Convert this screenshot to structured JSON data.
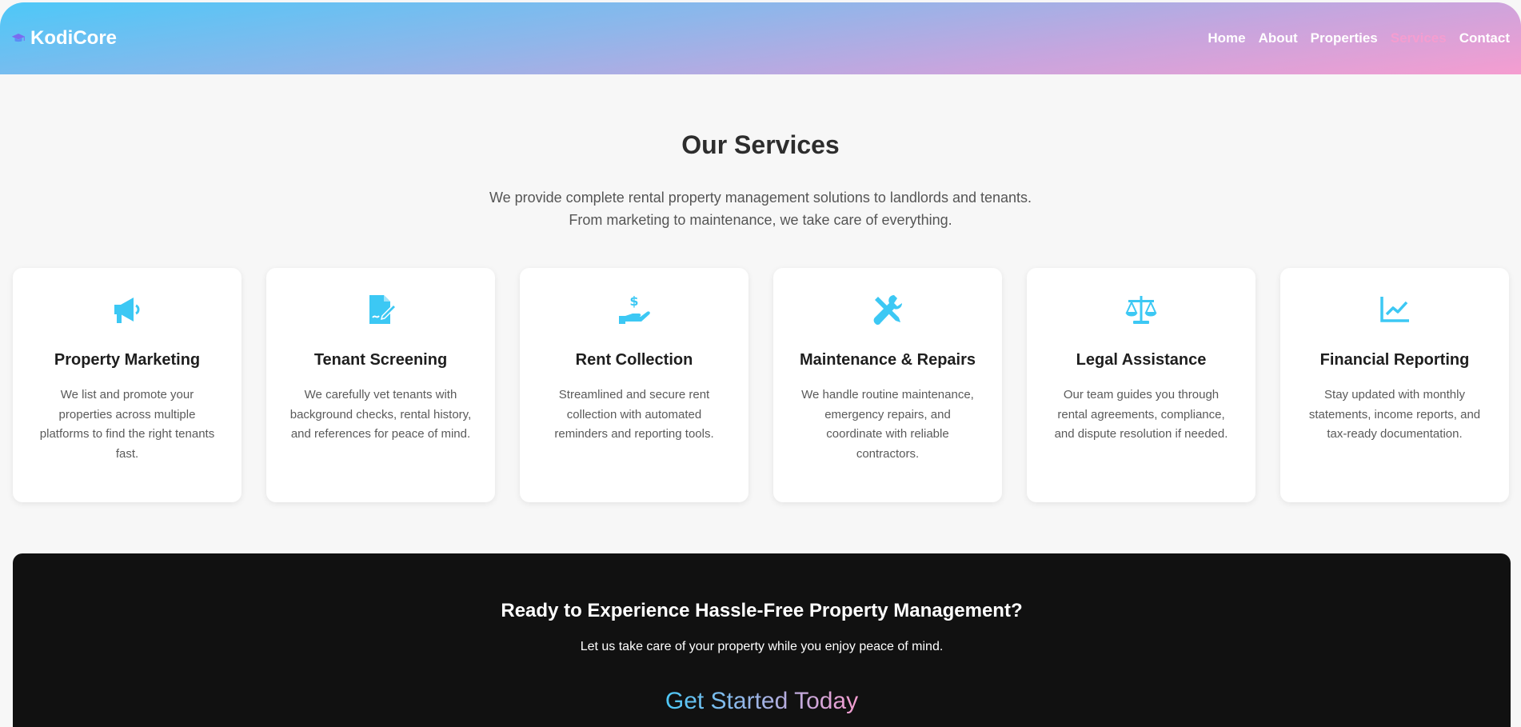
{
  "nav": {
    "brand": "KodiCore",
    "brand_icon": "graduation-cap-icon",
    "links": [
      "Home",
      "About",
      "Properties",
      "Services",
      "Contact"
    ],
    "active": "Services"
  },
  "services": {
    "title": "Our Services",
    "intro_line1": "We provide complete rental property management solutions to landlords and tenants.",
    "intro_line2": "From marketing to maintenance, we take care of everything.",
    "cards": [
      {
        "icon": "megaphone-icon",
        "title": "Property Marketing",
        "text": "We list and promote your properties across multiple platforms to find the right tenants fast."
      },
      {
        "icon": "signed-document-icon",
        "title": "Tenant Screening",
        "text": "We carefully vet tenants with background checks, rental history, and references for peace of mind."
      },
      {
        "icon": "hand-holding-dollar-icon",
        "title": "Rent Collection",
        "text": "Streamlined and secure rent collection with automated reminders and reporting tools."
      },
      {
        "icon": "tools-icon",
        "title": "Maintenance & Repairs",
        "text": "We handle routine maintenance, emergency repairs, and coordinate with reliable contractors."
      },
      {
        "icon": "scale-icon",
        "title": "Legal Assistance",
        "text": "Our team guides you through rental agreements, compliance, and dispute resolution if needed."
      },
      {
        "icon": "line-chart-icon",
        "title": "Financial Reporting",
        "text": "Stay updated with monthly statements, income reports, and tax-ready documentation."
      }
    ]
  },
  "cta": {
    "title": "Ready to Experience Hassle-Free Property Management?",
    "text": "Let us take care of your property while you enjoy peace of mind.",
    "button": "Get Started Today"
  },
  "colors": {
    "accent": "#3cc8f4",
    "active_link": "#f59dd0",
    "gradient_start": "#4dc8f8",
    "gradient_end": "#f59dd0",
    "cta_bg": "#111111"
  }
}
